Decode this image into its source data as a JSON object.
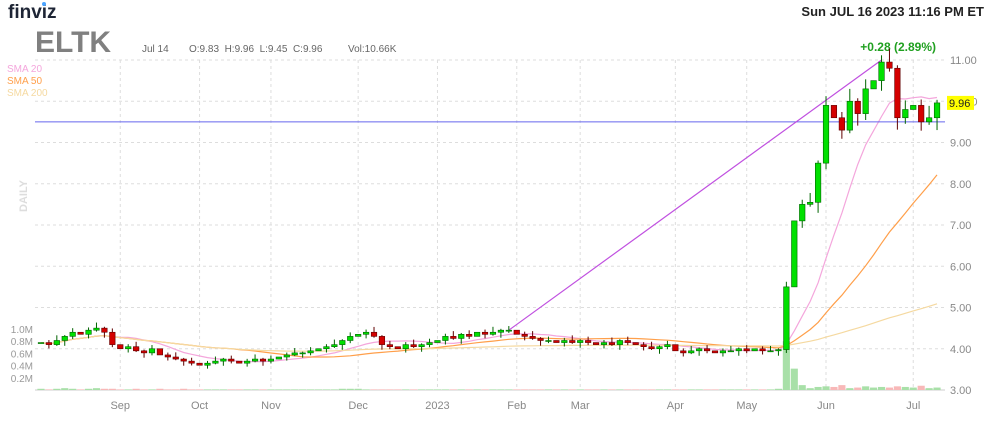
{
  "header": {
    "logo": "finviz",
    "datetime": "Sun JUL 16 2023 11:16 PM ET",
    "ticker": "ELTK",
    "bar_date": "Jul 14",
    "ohlc": "O:9.83  H:9.96  L:9.45  C:9.96",
    "volume": "Vol:10.66K",
    "change": "+0.28 (2.89%)",
    "timeframe": "DAILY"
  },
  "legend": [
    {
      "label": "SMA 20",
      "color": "#f4a6dc"
    },
    {
      "label": "SMA 50",
      "color": "#ff9f4a"
    },
    {
      "label": "SMA 200",
      "color": "#f5d9a0"
    }
  ],
  "colors": {
    "up": "#00e000",
    "down": "#d40000",
    "up_border": "#006400",
    "down_border": "#600000",
    "trendline": "#c050e0",
    "hline": "#6666ee",
    "price_label_bg": "#ffff00"
  },
  "chart_data": {
    "type": "candlestick",
    "ylim": [
      3.0,
      11.0
    ],
    "y_ticks": [
      "11.00",
      "10.00",
      "9.00",
      "8.00",
      "7.00",
      "6.00",
      "5.00",
      "4.00",
      "3.00"
    ],
    "y_tick_values": [
      11,
      10,
      9,
      8,
      7,
      6,
      5,
      4,
      3
    ],
    "x_ticks": [
      {
        "label": "Sep",
        "index": 10
      },
      {
        "label": "Oct",
        "index": 20
      },
      {
        "label": "Nov",
        "index": 29
      },
      {
        "label": "Dec",
        "index": 40
      },
      {
        "label": "2023",
        "index": 50
      },
      {
        "label": "Feb",
        "index": 60
      },
      {
        "label": "Mar",
        "index": 68
      },
      {
        "label": "Apr",
        "index": 80
      },
      {
        "label": "May",
        "index": 89
      },
      {
        "label": "Jun",
        "index": 99
      },
      {
        "label": "Jul",
        "index": 110
      }
    ],
    "volume_ticks": [
      "1.0M",
      "0.8M",
      "0.6M",
      "0.4M",
      "0.2M"
    ],
    "volume_tick_values": [
      1.0,
      0.8,
      0.6,
      0.4,
      0.2
    ],
    "last_price": "9.96",
    "closes": [
      4.15,
      4.1,
      4.2,
      4.3,
      4.4,
      4.35,
      4.45,
      4.5,
      4.4,
      4.1,
      4.0,
      4.05,
      3.95,
      3.9,
      4.0,
      3.85,
      3.8,
      3.75,
      3.7,
      3.65,
      3.6,
      3.65,
      3.7,
      3.75,
      3.7,
      3.65,
      3.7,
      3.75,
      3.7,
      3.75,
      3.8,
      3.85,
      3.9,
      3.9,
      3.95,
      4.0,
      4.05,
      4.1,
      4.2,
      4.3,
      4.35,
      4.4,
      4.3,
      4.1,
      4.05,
      4.0,
      4.1,
      4.05,
      4.1,
      4.15,
      4.2,
      4.3,
      4.25,
      4.35,
      4.3,
      4.4,
      4.35,
      4.4,
      4.45,
      4.45,
      4.35,
      4.3,
      4.25,
      4.2,
      4.2,
      4.15,
      4.2,
      4.15,
      4.2,
      4.15,
      4.1,
      4.15,
      4.1,
      4.2,
      4.15,
      4.1,
      4.05,
      4.0,
      4.05,
      4.1,
      3.95,
      3.9,
      3.95,
      4.0,
      3.95,
      3.9,
      3.95,
      3.95,
      4.0,
      3.95,
      4.0,
      3.95,
      3.95,
      3.98,
      5.5,
      7.1,
      7.5,
      7.55,
      8.5,
      9.9,
      9.6,
      9.3,
      10.0,
      9.7,
      10.3,
      10.5,
      10.95,
      10.8,
      9.6,
      9.8,
      9.9,
      9.5,
      9.6,
      9.96
    ],
    "volumes_m": [
      0.02,
      0.01,
      0.02,
      0.03,
      0.02,
      0.01,
      0.02,
      0.03,
      0.02,
      0.02,
      0.01,
      0.01,
      0.02,
      0.01,
      0.01,
      0.02,
      0.01,
      0.01,
      0.02,
      0.01,
      0.01,
      0.01,
      0.01,
      0.01,
      0.01,
      0.01,
      0.01,
      0.01,
      0.01,
      0.01,
      0.01,
      0.01,
      0.01,
      0.01,
      0.01,
      0.01,
      0.01,
      0.01,
      0.02,
      0.02,
      0.02,
      0.01,
      0.01,
      0.01,
      0.01,
      0.01,
      0.01,
      0.01,
      0.01,
      0.01,
      0.01,
      0.01,
      0.01,
      0.01,
      0.01,
      0.01,
      0.01,
      0.01,
      0.01,
      0.01,
      0.01,
      0.01,
      0.01,
      0.01,
      0.01,
      0.01,
      0.01,
      0.01,
      0.01,
      0.01,
      0.01,
      0.01,
      0.01,
      0.01,
      0.01,
      0.01,
      0.01,
      0.01,
      0.01,
      0.01,
      0.01,
      0.01,
      0.01,
      0.01,
      0.01,
      0.01,
      0.01,
      0.01,
      0.01,
      0.01,
      0.01,
      0.01,
      0.01,
      0.02,
      0.8,
      0.35,
      0.08,
      0.03,
      0.05,
      0.06,
      0.05,
      0.08,
      0.03,
      0.04,
      0.06,
      0.04,
      0.05,
      0.04,
      0.06,
      0.05,
      0.04,
      0.07,
      0.03,
      0.04
    ],
    "annotations": {
      "horizontal_line_price": 9.5,
      "trendline": {
        "from_index": 59,
        "from_price": 4.45,
        "to_index": 106,
        "to_price": 11.0
      }
    },
    "sma_periods_candles": [
      10,
      25,
      100
    ]
  }
}
